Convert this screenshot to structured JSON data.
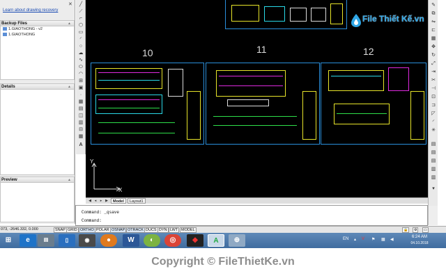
{
  "recovery": {
    "link": "Learn about drawing recovery",
    "backup_header": "Backup Files",
    "backup_files": [
      "1.GIAOTHONG - v2",
      "1.GIAOTHONG"
    ],
    "details_header": "Details",
    "preview_header": "Preview"
  },
  "canvas": {
    "sheet_numbers": [
      "10",
      "11",
      "12"
    ],
    "ucs_y": "Y",
    "ucs_x": "X"
  },
  "logo": {
    "text": "File Thiết Kế.vn"
  },
  "tabs": {
    "model": "Model",
    "layout1": "Layout1"
  },
  "command": {
    "line1": "Command: _qsave",
    "line2": "Command:"
  },
  "status": {
    "coordinates": "073, -2646.332, 0.000",
    "buttons": [
      "SNAP",
      "GRID",
      "ORTHO",
      "POLAR",
      "OSNAP",
      "OTRACK",
      "DUCS",
      "DYN",
      "LWT",
      "MODEL"
    ]
  },
  "taskbar": {
    "language": "EN",
    "time": "6:24 AM",
    "date": "04.10.2018",
    "apps": [
      "start-icon",
      "ie-icon",
      "app-icon",
      "notes-icon",
      "camera-icon",
      "firefox-icon",
      "word-icon",
      "android-icon",
      "chrome-icon",
      "app2-icon",
      "autocad-icon",
      "app3-icon"
    ]
  },
  "copyright": "Copyright © FileThietKe.vn",
  "colors": {
    "canvas_bg": "#000000",
    "sheet_border": "#2a8fdc",
    "cad_yellow": "#e8e52a",
    "cad_green": "#2ee04a",
    "cad_magenta": "#e02ae0",
    "cad_cyan": "#2ad9e8",
    "logo_blue": "#2fa6e6"
  }
}
